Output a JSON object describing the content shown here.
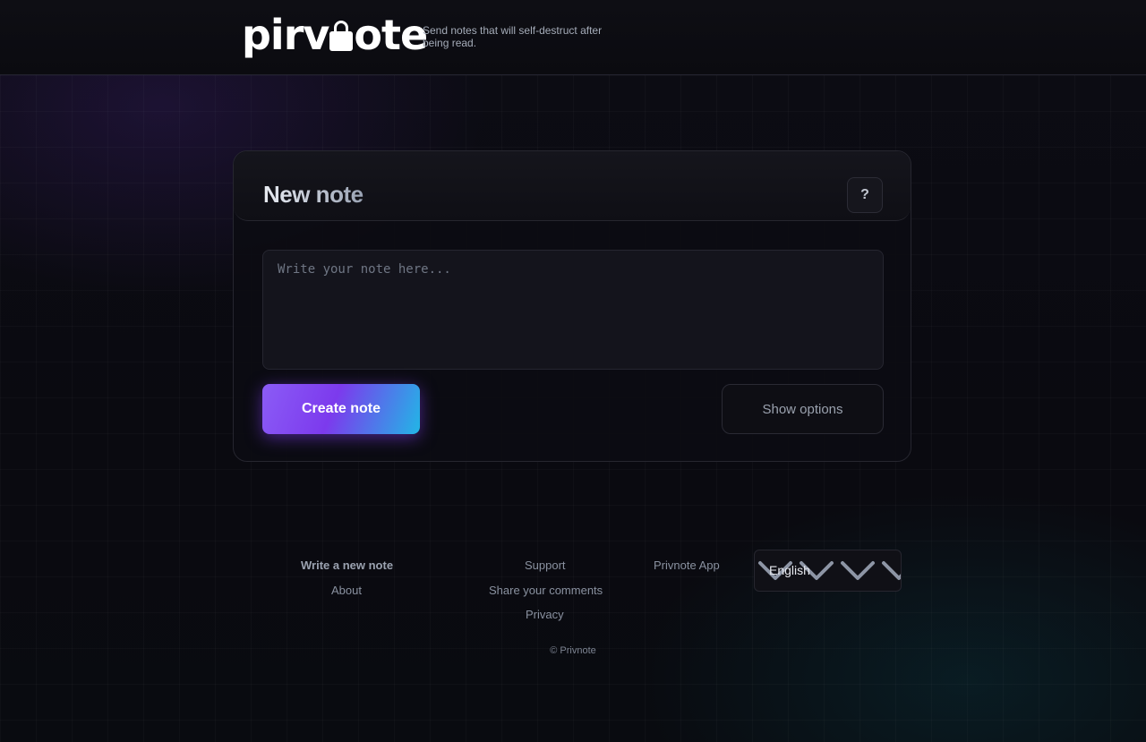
{
  "header": {
    "logo_left": "pirv",
    "logo_right": "ote",
    "tagline": "Send notes that will self-destruct after being read."
  },
  "note_card": {
    "title": "New note",
    "help_label": "?",
    "placeholder": "Write your note here...",
    "value": "",
    "create_label": "Create note",
    "options_label": "Show options"
  },
  "footer": {
    "links": {
      "write_new": "Write a new note",
      "about": "About",
      "support": "Support",
      "share_comments": "Share your comments",
      "privacy": "Privacy",
      "app": "Privnote App"
    },
    "language": {
      "selected": "English",
      "icon": "chevron-down-icon"
    },
    "copyright": "© Privnote"
  },
  "colors": {
    "background": "#0a0a10",
    "accent_purple": "#7c3aed",
    "accent_cyan": "#22b6e6",
    "text_muted": "#8a91a0"
  }
}
